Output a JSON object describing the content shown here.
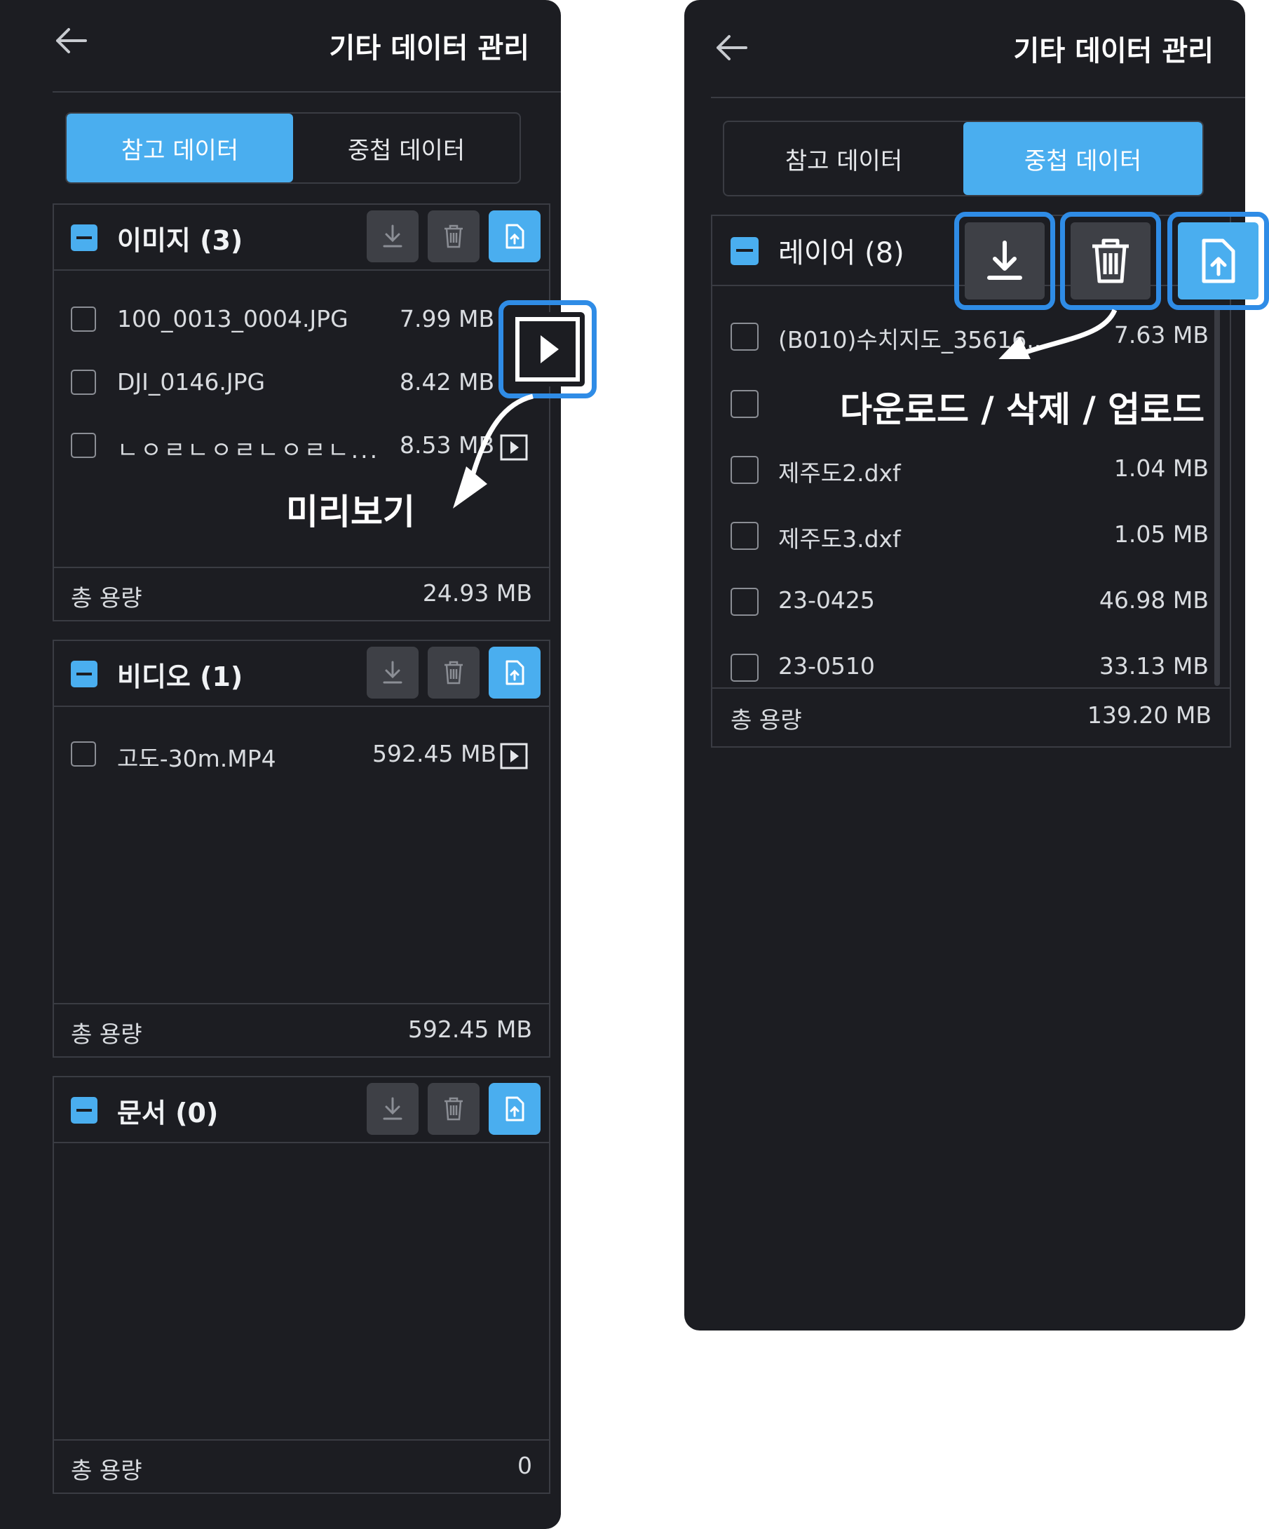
{
  "left": {
    "header": {
      "title": "기타 데이터 관리"
    },
    "tabs": [
      {
        "label": "참고 데이터",
        "active": true
      },
      {
        "label": "중첩 데이터",
        "active": false
      }
    ],
    "sections": [
      {
        "title": "이미지 (3)",
        "files": [
          {
            "name": "100_0013_0004.JPG",
            "size": "7.99 MB"
          },
          {
            "name": "DJI_0146.JPG",
            "size": "8.42 MB"
          },
          {
            "name": "ㄴㅇㄹㄴㅇㄹㄴㅇㄹㄴ...",
            "size": "8.53 MB"
          }
        ],
        "total_label": "총 용량",
        "total": "24.93 MB"
      },
      {
        "title": "비디오 (1)",
        "files": [
          {
            "name": "고도-30m.MP4",
            "size": "592.45 MB"
          }
        ],
        "total_label": "총 용량",
        "total": "592.45 MB"
      },
      {
        "title": "문서 (0)",
        "files": [],
        "total_label": "총 용량",
        "total": "0"
      }
    ],
    "callout": "미리보기"
  },
  "right": {
    "header": {
      "title": "기타 데이터 관리"
    },
    "tabs": [
      {
        "label": "참고 데이터",
        "active": false
      },
      {
        "label": "중첩 데이터",
        "active": true
      }
    ],
    "section": {
      "title": "레이어 (8)",
      "files": [
        {
          "name": "(B010)수치지도_35616...",
          "size": "7.63 MB"
        },
        {
          "name": "",
          "size": ""
        },
        {
          "name": "제주도2.dxf",
          "size": "1.04 MB"
        },
        {
          "name": "제주도3.dxf",
          "size": "1.05 MB"
        },
        {
          "name": "23-0425",
          "size": "46.98 MB"
        },
        {
          "name": "23-0510",
          "size": "33.13 MB"
        }
      ],
      "total_label": "총 용량",
      "total": "139.20 MB"
    },
    "callout": "다운로드 / 삭제 / 업로드"
  },
  "colors": {
    "accent": "#4aaeef",
    "panel": "#1c1d22",
    "highlight": "#2f8ce6"
  },
  "icons": [
    "back-arrow-icon",
    "download-icon",
    "trash-icon",
    "upload-file-icon",
    "play-icon"
  ]
}
